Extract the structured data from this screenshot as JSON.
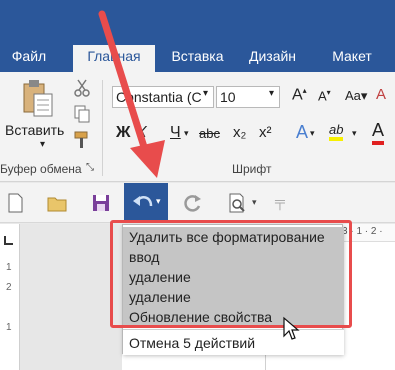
{
  "tabs": [
    {
      "label": "Файл",
      "active": false
    },
    {
      "label": "Главная",
      "active": true
    },
    {
      "label": "Вставка",
      "active": false
    },
    {
      "label": "Дизайн",
      "active": false
    },
    {
      "label": "Макет",
      "active": false
    }
  ],
  "clipboard": {
    "paste_label": "Вставить",
    "group_label": "Буфер обмена"
  },
  "font": {
    "family": "Constantia (С",
    "size": "10",
    "group_label": "Шрифт",
    "bold": "Ж",
    "italic": "К",
    "underline": "Ч",
    "strike": "abc",
    "subscript": "x₂",
    "superscript": "x²",
    "text_effects": "A",
    "highlight": "ab",
    "font_color": "A"
  },
  "ruler_mark": "3 · 1 · 2 ·",
  "vruler_marks": [
    "1",
    "2",
    "1"
  ],
  "undo_list": {
    "items": [
      "Удалить все форматирование",
      "ввод",
      "удаление",
      "удаление",
      "Обновление свойства"
    ],
    "footer": "Отмена 5 действий"
  },
  "colors": {
    "ribbon_blue": "#2b579a",
    "highlight": "#e84c4c"
  }
}
